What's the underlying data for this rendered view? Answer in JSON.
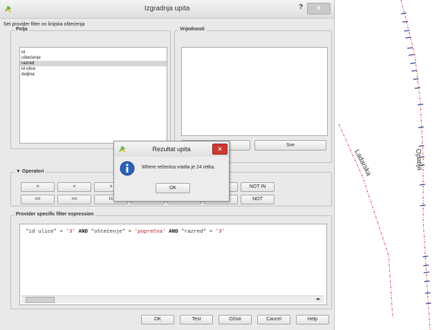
{
  "dialog": {
    "title": "Izgradnja upita",
    "help_label": "?",
    "close_label": "✕",
    "filter_caption": "Set provider filter on linijska oštećenja"
  },
  "fields": {
    "group_label": "Polja",
    "items": [
      "id",
      "oštećenje",
      "razred",
      "id ulice",
      "duljina"
    ],
    "selected_index": 2
  },
  "values": {
    "group_label": "Vrijednosti",
    "sample_label": "Uzorak",
    "all_label": "Sve",
    "partial_label": "r"
  },
  "operators": {
    "group_label": "Operatori",
    "row1": [
      "=",
      "<",
      ">",
      "LIKE",
      "%",
      "IN",
      "NOT IN"
    ],
    "row2": [
      "<=",
      ">=",
      "!=",
      "ILIKE",
      "AND",
      "OR",
      "NOT"
    ]
  },
  "expression": {
    "group_label": "Provider specific filter expression",
    "tokens": [
      {
        "t": "\"id ulice\"",
        "k": "n"
      },
      {
        "t": " = ",
        "k": "n"
      },
      {
        "t": "'3'",
        "k": "s"
      },
      {
        "t": " AND ",
        "k": "kw"
      },
      {
        "t": "\"oštećenje\"",
        "k": "n"
      },
      {
        "t": " = ",
        "k": "n"
      },
      {
        "t": "'poprečna'",
        "k": "s"
      },
      {
        "t": " AND ",
        "k": "kw"
      },
      {
        "t": "\"razred\"",
        "k": "n"
      },
      {
        "t": " = ",
        "k": "n"
      },
      {
        "t": "'3'",
        "k": "s"
      }
    ]
  },
  "buttons": [
    "OK",
    "Test",
    "Očisti",
    "Cancel",
    "Help"
  ],
  "popup": {
    "title": "Rezultat upita",
    "message": "Where rečenica vratila je 24 retka.",
    "ok_label": "OK",
    "close_label": "✕"
  },
  "map": {
    "street_labels": [
      "Ladarska",
      "Opatija"
    ],
    "line_color": "#d2383f",
    "tick_color": "#2a3f8f"
  }
}
